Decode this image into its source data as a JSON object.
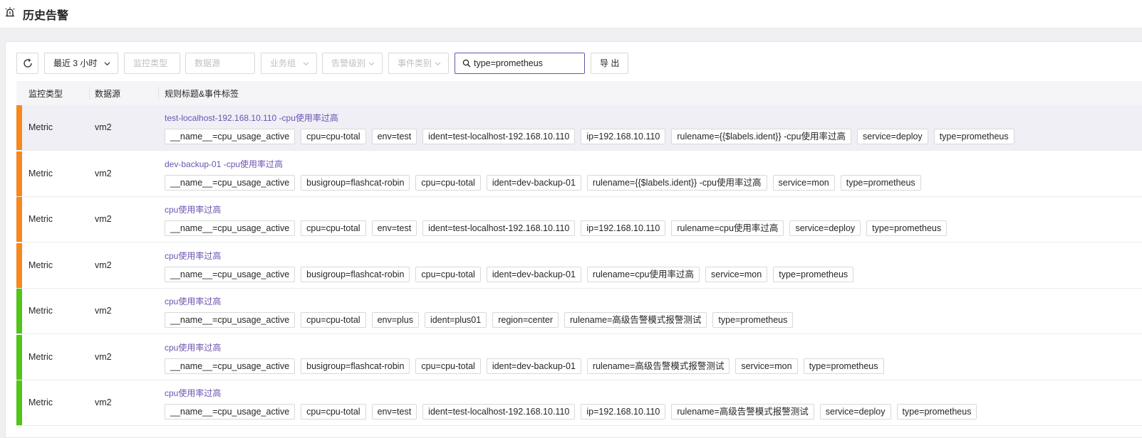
{
  "page": {
    "title": "历史告警",
    "icon": "alarm-icon"
  },
  "toolbar": {
    "refresh_icon": "refresh-icon",
    "time_range": "最近 3 小时",
    "monitor_type_placeholder": "监控类型",
    "datasource_placeholder": "数据源",
    "busi_group_placeholder": "业务组",
    "severity_placeholder": "告警级别",
    "event_type_placeholder": "事件类别",
    "search_value": "type=prometheus",
    "export_label": "导 出"
  },
  "table": {
    "columns": [
      "监控类型",
      "数据源",
      "规则标题&事件标签"
    ],
    "rows": [
      {
        "severity_color": "#f7871f",
        "monitor_type": "Metric",
        "datasource": "vm2",
        "title": "test-localhost-192.168.10.110 -cpu使用率过高",
        "tags": [
          "__name__=cpu_usage_active",
          "cpu=cpu-total",
          "env=test",
          "ident=test-localhost-192.168.10.110",
          "ip=192.168.10.110",
          "rulename={{$labels.ident}} -cpu使用率过高",
          "service=deploy",
          "type=prometheus"
        ]
      },
      {
        "severity_color": "#f7871f",
        "monitor_type": "Metric",
        "datasource": "vm2",
        "title": "dev-backup-01 -cpu使用率过高",
        "tags": [
          "__name__=cpu_usage_active",
          "busigroup=flashcat-robin",
          "cpu=cpu-total",
          "ident=dev-backup-01",
          "rulename={{$labels.ident}} -cpu使用率过高",
          "service=mon",
          "type=prometheus"
        ]
      },
      {
        "severity_color": "#f7871f",
        "monitor_type": "Metric",
        "datasource": "vm2",
        "title": "cpu使用率过高",
        "tags": [
          "__name__=cpu_usage_active",
          "cpu=cpu-total",
          "env=test",
          "ident=test-localhost-192.168.10.110",
          "ip=192.168.10.110",
          "rulename=cpu使用率过高",
          "service=deploy",
          "type=prometheus"
        ]
      },
      {
        "severity_color": "#f7871f",
        "monitor_type": "Metric",
        "datasource": "vm2",
        "title": "cpu使用率过高",
        "tags": [
          "__name__=cpu_usage_active",
          "busigroup=flashcat-robin",
          "cpu=cpu-total",
          "ident=dev-backup-01",
          "rulename=cpu使用率过高",
          "service=mon",
          "type=prometheus"
        ]
      },
      {
        "severity_color": "#52c41a",
        "monitor_type": "Metric",
        "datasource": "vm2",
        "title": "cpu使用率过高",
        "tags": [
          "__name__=cpu_usage_active",
          "cpu=cpu-total",
          "env=plus",
          "ident=plus01",
          "region=center",
          "rulename=高级告警模式报警测试",
          "type=prometheus"
        ]
      },
      {
        "severity_color": "#52c41a",
        "monitor_type": "Metric",
        "datasource": "vm2",
        "title": "cpu使用率过高",
        "tags": [
          "__name__=cpu_usage_active",
          "busigroup=flashcat-robin",
          "cpu=cpu-total",
          "ident=dev-backup-01",
          "rulename=高级告警模式报警测试",
          "service=mon",
          "type=prometheus"
        ]
      },
      {
        "severity_color": "#52c41a",
        "monitor_type": "Metric",
        "datasource": "vm2",
        "title": "cpu使用率过高",
        "tags": [
          "__name__=cpu_usage_active",
          "cpu=cpu-total",
          "env=test",
          "ident=test-localhost-192.168.10.110",
          "ip=192.168.10.110",
          "rulename=高级告警模式报警测试",
          "service=deploy",
          "type=prometheus"
        ]
      }
    ]
  }
}
